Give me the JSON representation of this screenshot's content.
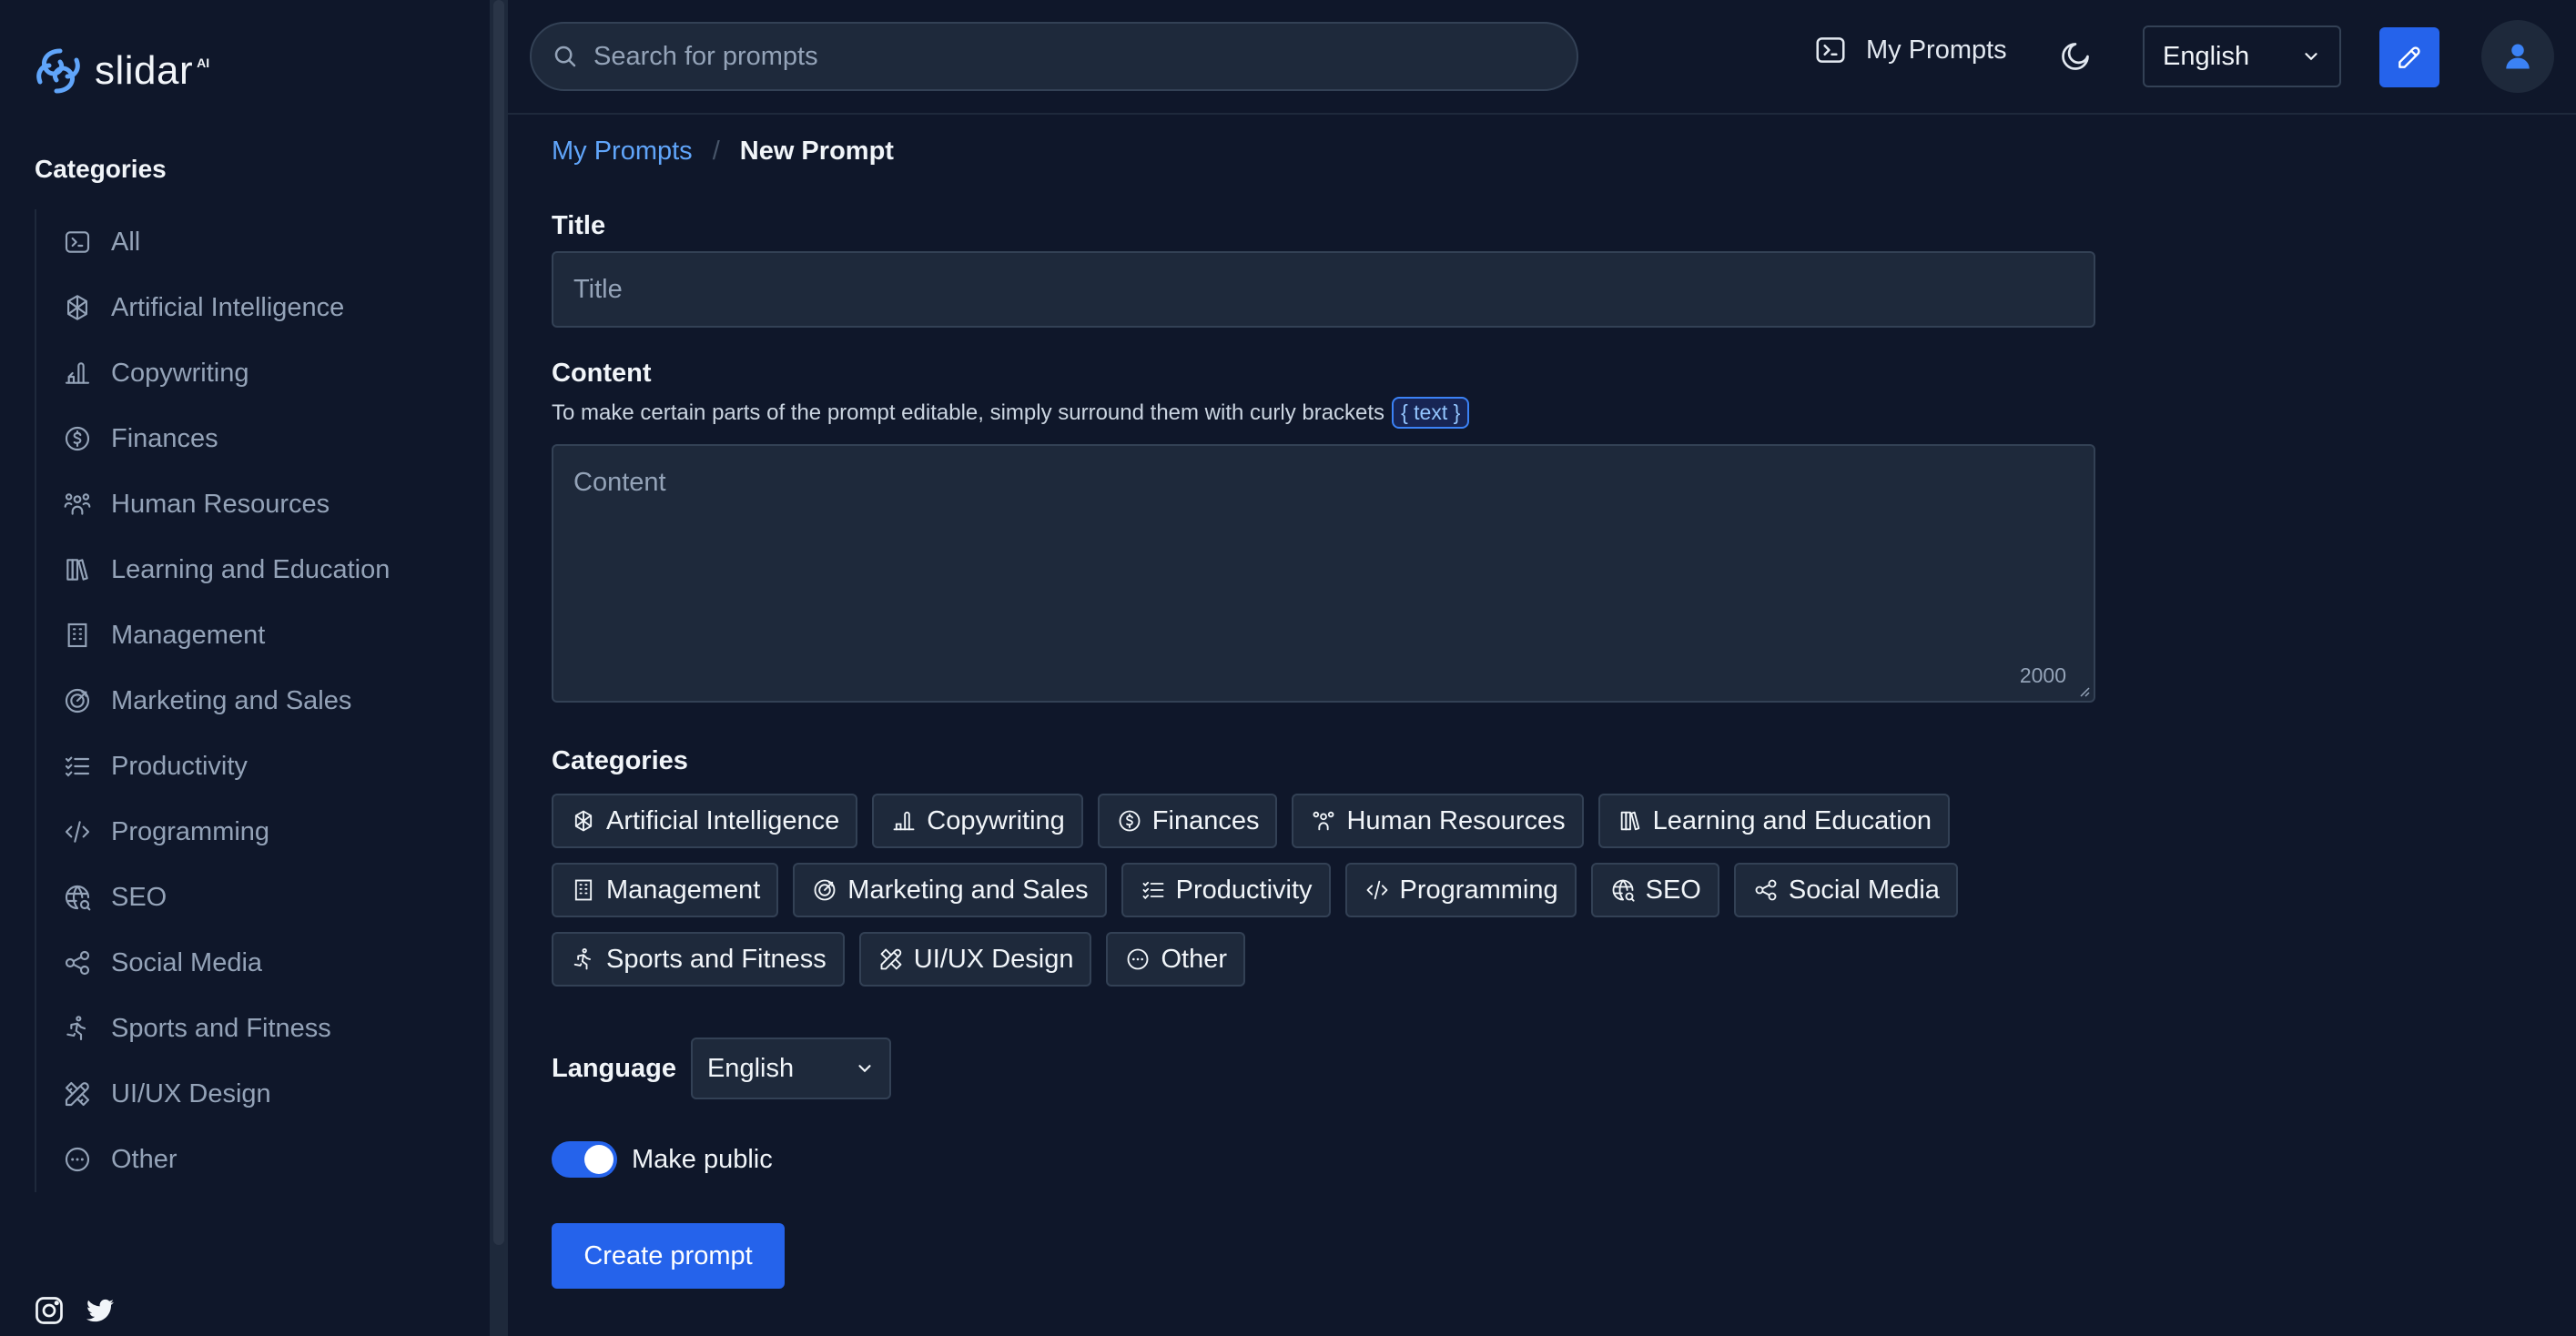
{
  "brand": {
    "name": "slidar",
    "sup": "AI"
  },
  "sidebar": {
    "heading": "Categories",
    "items": [
      {
        "label": "All",
        "icon": "terminal-icon"
      },
      {
        "label": "Artificial Intelligence",
        "icon": "openai-icon"
      },
      {
        "label": "Copywriting",
        "icon": "writing-hand-icon"
      },
      {
        "label": "Finances",
        "icon": "dollar-coin-icon"
      },
      {
        "label": "Human Resources",
        "icon": "users-icon"
      },
      {
        "label": "Learning and Education",
        "icon": "books-icon"
      },
      {
        "label": "Management",
        "icon": "building-icon"
      },
      {
        "label": "Marketing and Sales",
        "icon": "target-icon"
      },
      {
        "label": "Productivity",
        "icon": "checklist-icon"
      },
      {
        "label": "Programming",
        "icon": "code-icon"
      },
      {
        "label": "SEO",
        "icon": "world-search-icon"
      },
      {
        "label": "Social Media",
        "icon": "share-icon"
      },
      {
        "label": "Sports and Fitness",
        "icon": "running-icon"
      },
      {
        "label": "UI/UX Design",
        "icon": "tools-icon"
      },
      {
        "label": "Other",
        "icon": "dots-circle-icon"
      }
    ]
  },
  "topbar": {
    "search_placeholder": "Search for prompts",
    "my_prompts": "My Prompts",
    "language": "English"
  },
  "breadcrumb": {
    "parent": "My Prompts",
    "separator": "/",
    "current": "New Prompt"
  },
  "form": {
    "title_label": "Title",
    "title_placeholder": "Title",
    "content_label": "Content",
    "content_hint": "To make certain parts of the prompt editable, simply surround them with curly brackets",
    "content_hint_tag": "{ text }",
    "content_placeholder": "Content",
    "content_counter": "2000",
    "categories_label": "Categories",
    "categories": [
      [
        "Artificial Intelligence",
        "Copywriting",
        "Finances",
        "Human Resources",
        "Learning and Education"
      ],
      [
        "Management",
        "Marketing and Sales",
        "Productivity",
        "Programming",
        "SEO",
        "Social Media"
      ],
      [
        "Sports and Fitness",
        "UI/UX Design",
        "Other"
      ]
    ],
    "language_label": "Language",
    "language_value": "English",
    "make_public_label": "Make public",
    "make_public": true,
    "submit_label": "Create prompt"
  },
  "colors": {
    "accent": "#2563eb",
    "link": "#60a5fa",
    "background": "#0f172a",
    "surface": "#1e293b"
  }
}
